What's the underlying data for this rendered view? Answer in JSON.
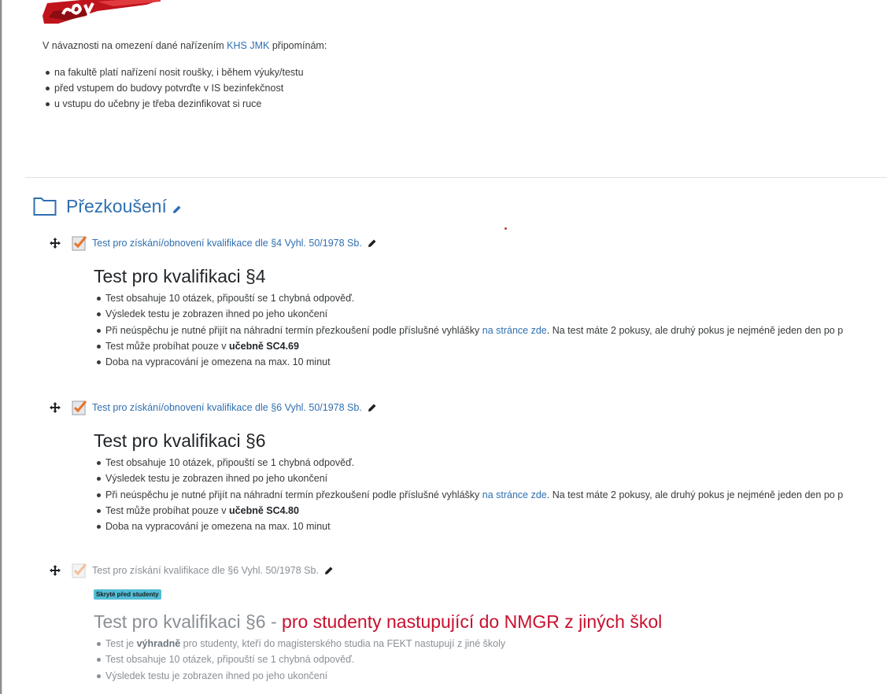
{
  "banner": {
    "logo": "covid-stamp-logo"
  },
  "intro": {
    "text_before": "V návaznosti na omezení dané nařízením ",
    "link": "KHS JMK",
    "text_after": " připomínám:",
    "bullets": [
      "na fakultě platí nařízení nosit roušky, i během výuky/testu",
      "před vstupem do budovy potvrďte v IS bezinfekčnost",
      "u vstupu do učebny je třeba dezinfikovat si ruce"
    ]
  },
  "section": {
    "title": "Přezkoušení",
    "icon": "folder-icon"
  },
  "activities": [
    {
      "name": "Test pro získání/obnovení kvalifikace dle §4 Vyhl. 50/1978 Sb.",
      "heading": "Test pro kvalifikaci §4",
      "b1": "Test obsahuje 10 otázek, připouští se 1 chybná odpověď.",
      "b2": "Výsledek testu je zobrazen ihned po jeho ukončení",
      "b3_before": "Při neúspěchu je nutné přijít na náhradní termín přezkoušení podle příslušné vyhlášky ",
      "b3_link": "na stránce zde",
      "b3_after": ". Na test máte 2 pokusy, ale druhý pokus je nejméně jeden den po p",
      "b4_before": "Test může probíhat pouze v ",
      "b4_bold": "učebně SC4.69",
      "b5": "Doba na vypracování je omezena na max. 10 minut"
    },
    {
      "name": "Test pro získání/obnovení kvalifikace dle §6 Vyhl. 50/1978 Sb.",
      "heading": "Test pro kvalifikaci §6",
      "b1": "Test obsahuje 10 otázek, připouští se 1 chybná odpověď.",
      "b2": "Výsledek testu je zobrazen ihned po jeho ukončení",
      "b3_before": "Při neúspěchu je nutné přijít na náhradní termín přezkoušení podle příslušné vyhlášky ",
      "b3_link": "na stránce zde",
      "b3_after": ". Na test máte 2 pokusy, ale druhý pokus je nejméně jeden den po p",
      "b4_before": "Test může probíhat pouze v ",
      "b4_bold": "učebně SC4.80",
      "b5": "Doba na vypracování je omezena na max. 10 minut"
    },
    {
      "name": "Test pro získání kvalifikace dle §6 Vyhl. 50/1978 Sb.",
      "badge": "Skryté před studenty",
      "heading_gray": "Test pro kvalifikaci §6 - ",
      "heading_red": "pro studenty nastupující do NMGR z jiných škol",
      "b1_before": "Test je ",
      "b1_bold": "výhradně",
      "b1_after": " pro studenty, kteří do magisterského studia na FEKT nastupují z jiné školy",
      "b2": "Test obsahuje 10 otázek, připouští se 1 chybná odpověď.",
      "b3": "Výsledek testu je zobrazen ihned po jeho ukončení"
    }
  ],
  "colors": {
    "link": "#2f6fb1",
    "hidden_badge": "#53bdd6",
    "red_text": "#c8102e",
    "muted": "#8a8f95"
  }
}
